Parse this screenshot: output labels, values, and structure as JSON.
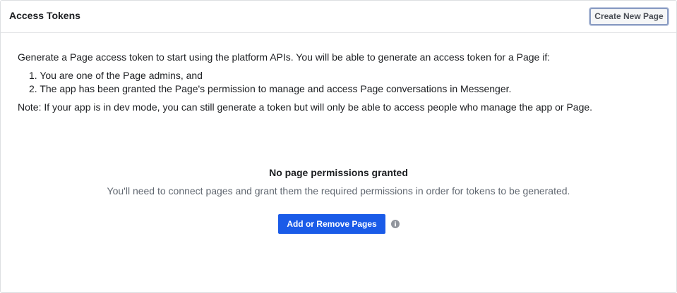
{
  "header": {
    "title": "Access Tokens",
    "create_button_label": "Create New Page"
  },
  "intro": {
    "lead": "Generate a Page access token to start using the platform APIs. You will be able to generate an access token for a Page if:",
    "conditions": [
      "1. You are one of the Page admins, and",
      "2. The app has been granted the Page's permission to manage and access Page conversations in Messenger."
    ],
    "note": "Note: If your app is in dev mode, you can still generate a token but will only be able to access people who manage the app or Page."
  },
  "empty_state": {
    "title": "No page permissions granted",
    "subtitle": "You'll need to connect pages and grant them the required permissions in order for tokens to be generated.",
    "action_label": "Add or Remove Pages",
    "info_icon": "info-icon"
  },
  "colors": {
    "primary_button": "#1a5be8",
    "border": "#dddfe2",
    "muted_text": "#606770"
  }
}
